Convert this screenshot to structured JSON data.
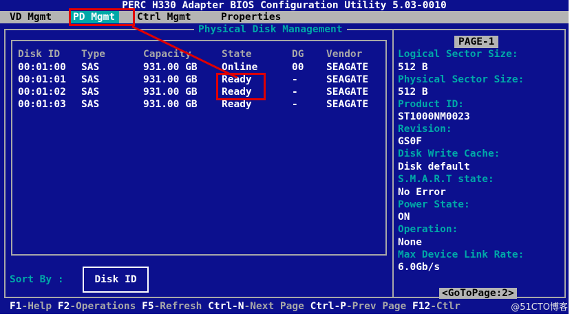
{
  "title": "PERC H330 Adapter BIOS Configuration Utility 5.03-0010",
  "menu": [
    {
      "label": "VD Mgmt",
      "active": false
    },
    {
      "label": "PD Mgmt",
      "active": true
    },
    {
      "label": "Ctrl Mgmt",
      "active": false
    },
    {
      "label": "Properties",
      "active": false
    }
  ],
  "section_title": "Physical Disk Management",
  "table": {
    "headers": [
      "Disk ID",
      "Type",
      "Capacity",
      "State",
      "DG",
      "Vendor"
    ],
    "rows": [
      [
        "00:01:00",
        "SAS",
        "931.00 GB",
        "Online",
        "00",
        "SEAGATE"
      ],
      [
        "00:01:01",
        "SAS",
        "931.00 GB",
        "Ready",
        "-",
        "SEAGATE"
      ],
      [
        "00:01:02",
        "SAS",
        "931.00 GB",
        "Ready",
        "-",
        "SEAGATE"
      ],
      [
        "00:01:03",
        "SAS",
        "931.00 GB",
        "Ready",
        "-",
        "SEAGATE"
      ]
    ]
  },
  "details": {
    "page": "PAGE-1",
    "items": [
      {
        "label": "Logical Sector Size:",
        "value": "512 B"
      },
      {
        "label": "Physical Sector Size:",
        "value": "512 B"
      },
      {
        "label": "Product ID:",
        "value": "ST1000NM0023"
      },
      {
        "label": "Revision:",
        "value": "GS0F"
      },
      {
        "label": "Disk Write Cache:",
        "value": "Disk default"
      },
      {
        "label": "S.M.A.R.T state:",
        "value": "No Error"
      },
      {
        "label": "Power State:",
        "value": "ON"
      },
      {
        "label": "Operation:",
        "value": "None"
      },
      {
        "label": "Max Device Link Rate:",
        "value": "6.0Gb/s"
      }
    ],
    "goto": "<GoToPage:2>"
  },
  "sort": {
    "label": "Sort By :",
    "button": "Disk ID"
  },
  "helpbar": [
    {
      "key": "F1",
      "desc": "-Help "
    },
    {
      "key": "F2",
      "desc": "-Operations "
    },
    {
      "key": "F5",
      "desc": "-Refresh "
    },
    {
      "key": "Ctrl-N",
      "desc": "-Next Page "
    },
    {
      "key": "Ctrl-P",
      "desc": "-Prev Page "
    },
    {
      "key": "F12",
      "desc": "-Ctlr"
    }
  ],
  "watermark": "@51CTO博客",
  "colors": {
    "background": "#0c108e",
    "accent": "#00a8a8",
    "menu": "#b4b4b4",
    "annotation": "#e00000"
  }
}
